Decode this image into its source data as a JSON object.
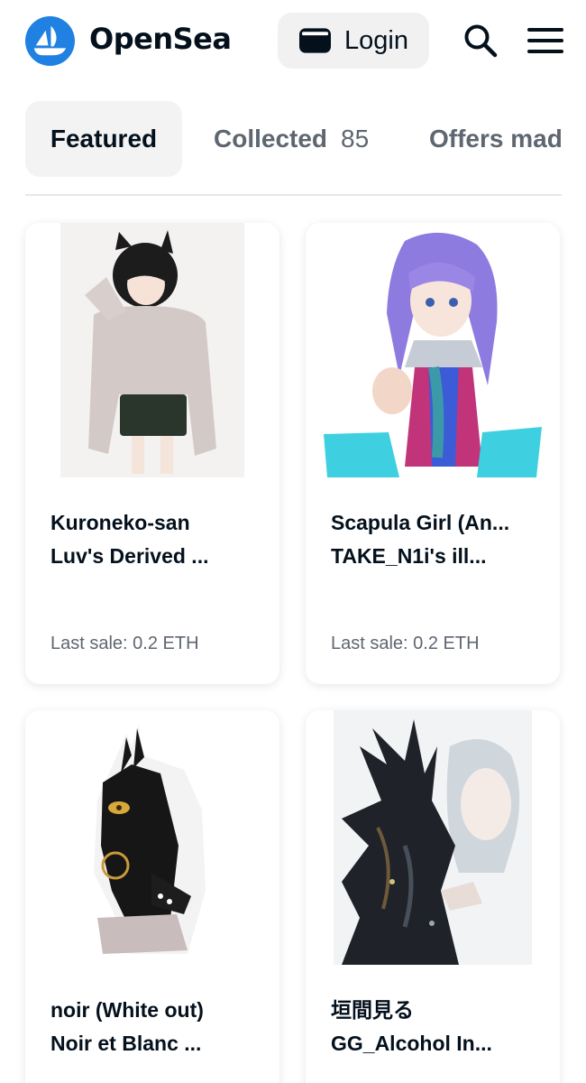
{
  "header": {
    "brand": "OpenSea",
    "login_label": "Login",
    "icons": [
      "opensea-logo",
      "wallet-icon",
      "search-icon",
      "menu-icon"
    ],
    "brand_color": "#2081e2"
  },
  "tabs": [
    {
      "label": "Featured",
      "active": true
    },
    {
      "label": "Collected",
      "count": "85"
    },
    {
      "label": "Offers mad"
    }
  ],
  "cards": [
    {
      "title": "Kuroneko-san",
      "collection": "Luv's Derived ...",
      "last_sale": "Last sale: 0.2 ETH"
    },
    {
      "title": "Scapula Girl (An...",
      "collection": "TAKE_N1i's ill...",
      "last_sale": "Last sale: 0.2 ETH"
    },
    {
      "title": "noir (White out)",
      "collection": "Noir et Blanc ..."
    },
    {
      "title": "垣間見る",
      "collection": "GG_Alcohol In..."
    }
  ]
}
